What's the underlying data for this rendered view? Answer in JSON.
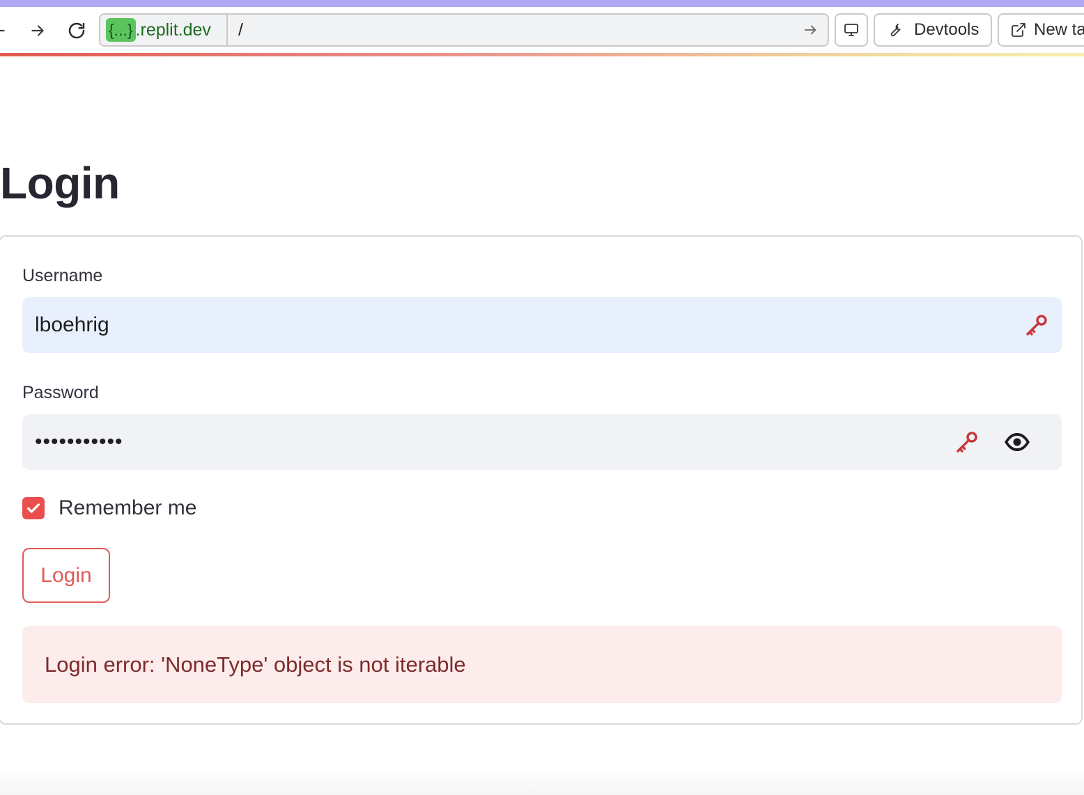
{
  "browser": {
    "url_chip": "{...}",
    "url_host": ".replit.dev",
    "url_path": "/",
    "devtools_label": "Devtools",
    "new_tab_label": "New ta"
  },
  "page": {
    "title": "Login"
  },
  "form": {
    "username_label": "Username",
    "username_value": "lboehrig",
    "password_label": "Password",
    "password_masked": "•••••••••••",
    "remember_label": "Remember me",
    "remember_checked": true,
    "login_button": "Login",
    "error_message": "Login error: 'NoneType' object is not iterable"
  },
  "colors": {
    "accent": "#e25a55",
    "checkbox": "#ea4e4e",
    "error_bg": "#fdecec",
    "error_text": "#7d2b2b",
    "username_bg": "#e8effd",
    "password_bg": "#f0f2f6"
  }
}
